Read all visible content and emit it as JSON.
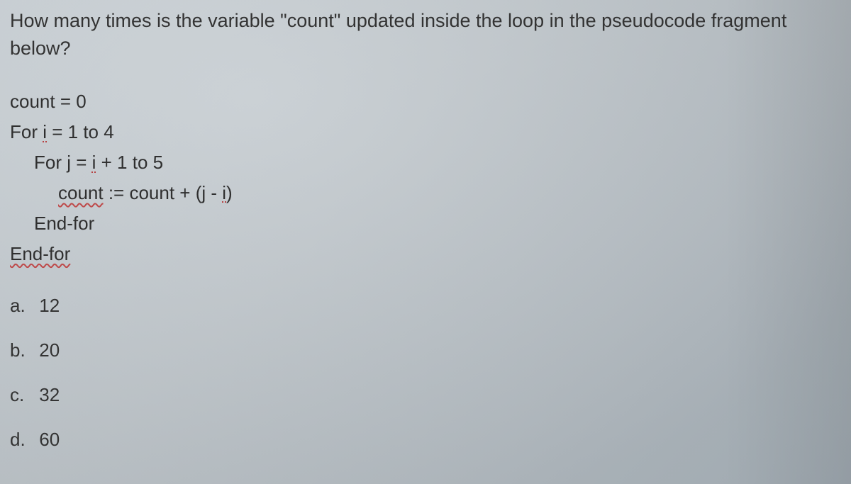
{
  "question": {
    "text": "How many times is the variable \"count\" updated inside the loop in the pseudocode fragment below?"
  },
  "code": {
    "l1_a": "count",
    "l1_b": " = 0",
    "l2_a": "For ",
    "l2_b": "i",
    "l2_c": " = 1 to 4",
    "l3_a": "For j = ",
    "l3_b": "i",
    "l3_c": " + 1 to 5",
    "l4_a": "count",
    "l4_b": " := count + (j - ",
    "l4_c": "i",
    "l4_d": ")",
    "l5": "End-for",
    "l6": "End-for"
  },
  "options": {
    "a": {
      "label": "a.",
      "value": "12"
    },
    "b": {
      "label": "b.",
      "value": "20"
    },
    "c": {
      "label": "c.",
      "value": "32"
    },
    "d": {
      "label": "d.",
      "value": "60"
    }
  }
}
